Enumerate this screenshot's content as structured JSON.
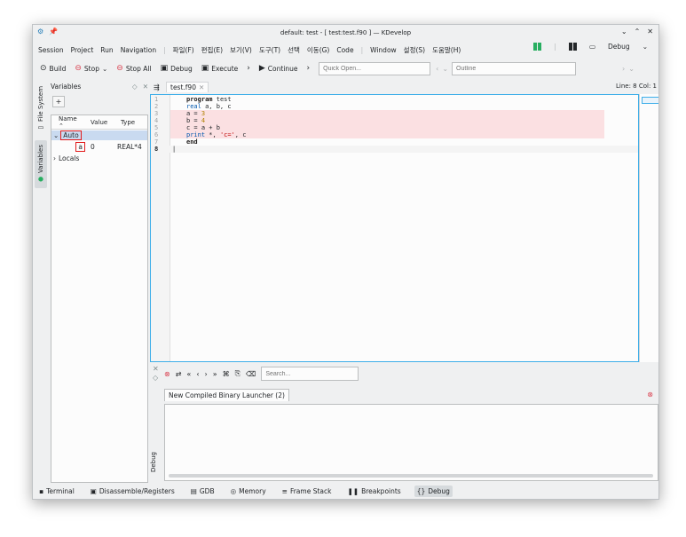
{
  "window": {
    "title": "default: test - [ test:test.f90 ] — KDevelop",
    "controls": {
      "minimize": "⌄",
      "maximize": "⌃",
      "close": "✕"
    }
  },
  "menubar": {
    "items": [
      "Session",
      "Project",
      "Run",
      "Navigation",
      "파일(F)",
      "편집(E)",
      "보기(V)",
      "도구(T)",
      "선택",
      "이동(G)",
      "Code",
      "Window",
      "설정(S)",
      "도움말(H)"
    ],
    "debug_label": "Debug"
  },
  "toolbar": {
    "build": "Build",
    "stop": "Stop",
    "stop_all": "Stop All",
    "debug": "Debug",
    "execute": "Execute",
    "continue": "Continue",
    "quick_open_placeholder": "Quick Open...",
    "outline_placeholder": "Outline"
  },
  "left_tabs": {
    "file_system": "File System",
    "variables": "Variables"
  },
  "variables_panel": {
    "title": "Variables",
    "add_label": "+",
    "columns": [
      "Name",
      "Value",
      "Type"
    ],
    "groups": [
      {
        "name": "Auto",
        "expanded": true,
        "vars": [
          {
            "name": "a",
            "value": "0",
            "type": "REAL*4"
          }
        ]
      },
      {
        "name": "Locals",
        "expanded": false,
        "vars": []
      }
    ]
  },
  "editor": {
    "tab_label": "test.f90",
    "position": "Line: 8 Col: 1",
    "lines": [
      {
        "no": "1",
        "code": "    program test"
      },
      {
        "no": "2",
        "code": "    real a, b, c"
      },
      {
        "no": "3",
        "code": "    a = 3"
      },
      {
        "no": "4",
        "code": "    b = 4"
      },
      {
        "no": "5",
        "code": "    c = a + b"
      },
      {
        "no": "6",
        "code": "    print *, 'c=', c"
      },
      {
        "no": "7",
        "code": "    end"
      },
      {
        "no": "8",
        "code": ""
      }
    ]
  },
  "output": {
    "search_placeholder": "Search...",
    "tab_label": "New Compiled Binary Launcher (2)",
    "side_label": "Debug"
  },
  "statusbar": {
    "items": [
      "Terminal",
      "Disassemble/Registers",
      "GDB",
      "Memory",
      "Frame Stack",
      "Breakpoints",
      "Debug"
    ]
  },
  "colors": {
    "accent": "#3daee9",
    "highlight": "#fbe0e2",
    "annotation": "#e21b1b"
  }
}
